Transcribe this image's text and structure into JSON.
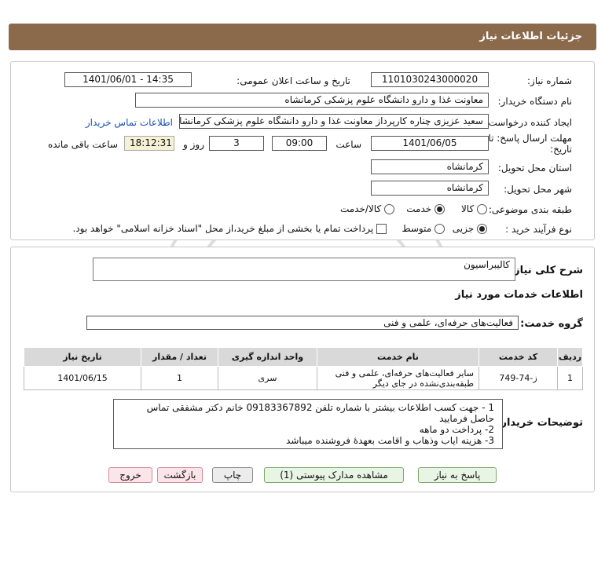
{
  "header": {
    "title": "جزئیات اطلاعات نیاز"
  },
  "form": {
    "need_number_label": "شماره نیاز:",
    "need_number": "1101030243000020",
    "announce_label": "تاریخ و ساعت اعلان عمومی:",
    "announce_value": "1401/06/01 - 14:35",
    "buyer_org_label": "نام دستگاه خریدار:",
    "buyer_org": "معاونت غذا و دارو دانشگاه علوم پزشکی کرمانشاه",
    "creator_label": "ایجاد کننده درخواست:",
    "creator": "سعید عزیزی چناره کارپرداز معاونت غذا و دارو دانشگاه علوم پزشکی کرمانشاه",
    "contact_link": "اطلاعات تماس خریدار",
    "deadline_label_1": "مهلت ارسال پاسخ: تا",
    "deadline_label_2": "تاریخ:",
    "deadline_date": "1401/06/05",
    "time_label": "ساعت",
    "deadline_time": "09:00",
    "days_value": "3",
    "days_label": "روز و",
    "remaining_time": "18:12:31",
    "remaining_label": "ساعت باقی مانده",
    "province_label": "استان محل تحویل:",
    "province": "کرمانشاه",
    "city_label": "شهر محل تحویل:",
    "city": "کرمانشاه",
    "category_label": "طبقه بندی موضوعی:",
    "category_options": [
      "کالا",
      "خدمت",
      "کالا/خدمت"
    ],
    "category_selected": "خدمت",
    "process_label": "نوع فرآیند خرید :",
    "process_options": [
      "جزیی",
      "متوسط"
    ],
    "process_selected": "جزیی",
    "treasury_note": "پرداخت تمام یا بخشی از مبلغ خرید،از محل \"اسناد خزانه اسلامی\" خواهد بود."
  },
  "details": {
    "summary_label": "شرح کلی نیاز:",
    "summary": "کالیبراسیون",
    "services_heading": "اطلاعات خدمات مورد نیاز",
    "service_group_label": "گروه خدمت:",
    "service_group": "فعالیت‌های حرفه‌ای، علمی و فنی",
    "table": {
      "headers": [
        "ردیف",
        "کد خدمت",
        "نام خدمت",
        "واحد اندازه گیری",
        "تعداد / مقدار",
        "تاریخ نیاز"
      ],
      "rows": [
        [
          "1",
          "ز-74-749",
          "سایر فعالیت‌های حرفه‌ای، علمی و فنی طبقه‌بندی‌نشده در جای دیگر",
          "سری",
          "1",
          "1401/06/15"
        ]
      ]
    },
    "buyer_notes_label": "توضیحات خریدار:",
    "buyer_notes": [
      "1 - جهت کسب اطلاعات بیشتر با شماره تلفن 09183367892 خانم دکتر مشفقی تماس حاصل فرمایید",
      "2-  پرداخت   دو ماهه",
      "3- هزینه ایاب وذهاب و اقامت بعهدهٔ فروشنده میباشد"
    ]
  },
  "buttons": {
    "respond": "پاسخ به نیاز",
    "view_docs": "مشاهده مدارک پیوستی (1)",
    "print": "چاپ",
    "back": "بازگشت",
    "exit": "خروج"
  },
  "colors": {
    "header_bg": "#8b6a4b",
    "link": "#1a4fb5",
    "timer_bg": "#f6f1d4"
  }
}
